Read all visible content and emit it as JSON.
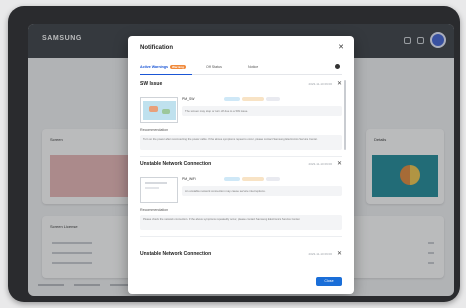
{
  "app": {
    "brand": "SAMSUNG"
  },
  "background": {
    "card_left_title": "Screen",
    "card_list_title": "Screen License",
    "card_right_title": "Details",
    "list_items": [
      "Item",
      "Item",
      "Item"
    ]
  },
  "modal": {
    "title": "Notification",
    "close_icon": "close-icon",
    "tabs": [
      {
        "label": "Active Warnings",
        "badge": "Warning",
        "active": true
      },
      {
        "label": "Off Status",
        "active": false
      },
      {
        "label": "Notice",
        "active": false
      }
    ],
    "sections": [
      {
        "title": "SW Issue",
        "meta": "2023-11-10  09:00",
        "device": "PM_SW",
        "description": "The screen may stop or turn off due to a SW issue.",
        "recommendation_label": "Recommendation",
        "recommendation": "Turn on the power after reconnecting the power cable. If the above symptoms repeat to occur, please contact Samsung Electronics Service Center."
      },
      {
        "title": "Unstable Network Connection",
        "meta": "2023-11-10  09:00",
        "device": "PM_WiFi",
        "description": "An unstable network connection may cause service interruptions.",
        "recommendation_label": "Recommendation",
        "recommendation": "Please check the network connection. If the above symptoms repeatedly occur, please contact Samsung Electronics Service Center."
      },
      {
        "title": "Unstable Network Connection",
        "meta": "2023-11-10  09:00"
      }
    ],
    "close_label": "Close"
  },
  "colors": {
    "accent": "#1a6ed8",
    "warning_badge": "#f08a3c",
    "tag_colors": [
      "#cfe8f7",
      "#f8e3c5",
      "#e9eaf0"
    ]
  }
}
